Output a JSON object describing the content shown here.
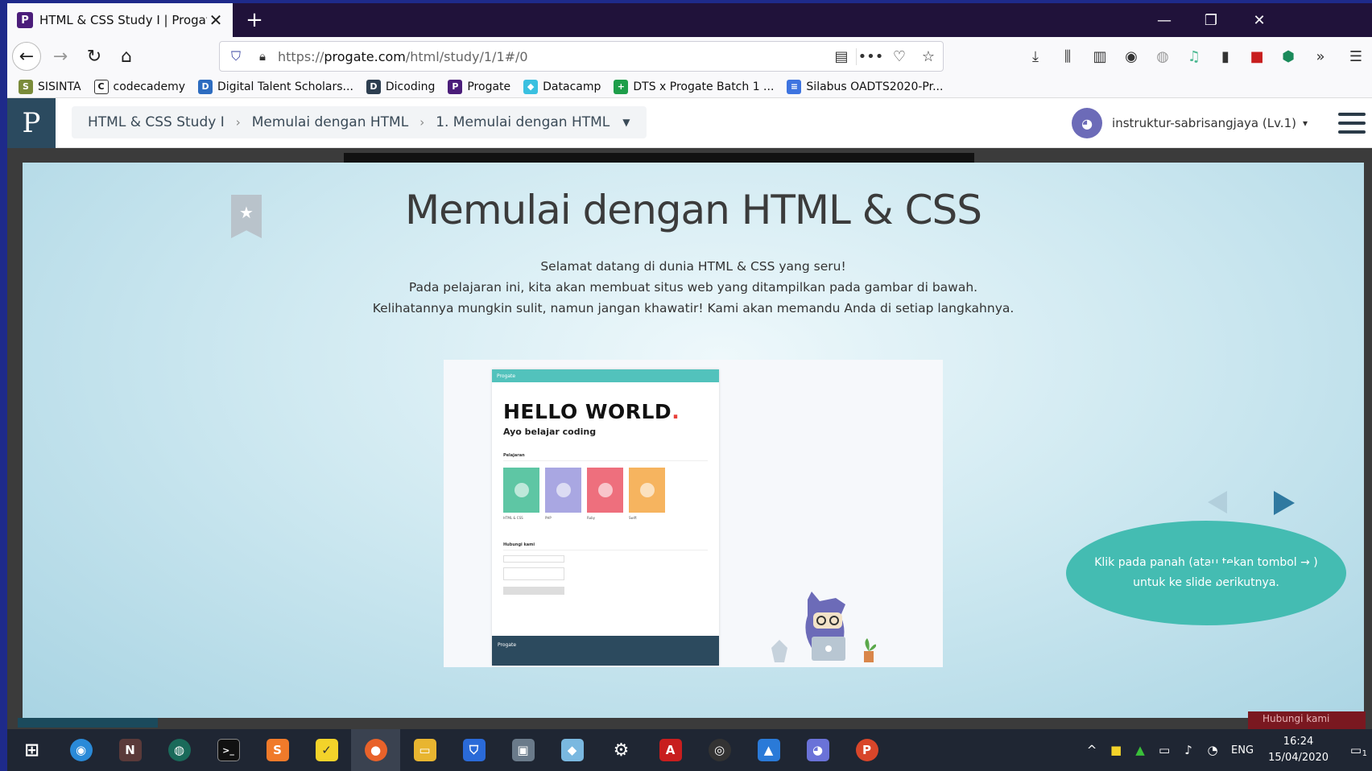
{
  "browser": {
    "tab_favicon": "P",
    "tab_title": "HTML & CSS Study I | Progate -",
    "tab_close": "✕",
    "new_tab": "+",
    "win_min": "—",
    "win_restore": "❐",
    "win_close": "✕",
    "back": "←",
    "forward": "→",
    "reload": "↻",
    "home": "⌂",
    "url_prefix": "https://",
    "url_host": "progate.com",
    "url_path": "/html/study/1/1#/0",
    "url_menu": "•••",
    "toolbar_icons": [
      "download-icon",
      "library-icon",
      "sidebar-icon",
      "account-icon",
      "globe-icon",
      "music-icon",
      "extension-icon",
      "pdf-icon",
      "shield-ext-icon",
      "overflow-icon",
      "menu-icon"
    ]
  },
  "bookmarks": [
    {
      "label": "SISINTA",
      "icon": "sisinta-icon",
      "color": "#7a8b3a",
      "glyph": "S"
    },
    {
      "label": "codecademy",
      "icon": "codecademy-icon",
      "color": "#ffffff",
      "glyph": "C"
    },
    {
      "label": "Digital Talent Scholars...",
      "icon": "dts-icon",
      "color": "#2d6cc0",
      "glyph": "D"
    },
    {
      "label": "Dicoding",
      "icon": "dicoding-icon",
      "color": "#2d3e50",
      "glyph": "D"
    },
    {
      "label": "Progate",
      "icon": "progate-icon",
      "color": "#4b1d7a",
      "glyph": "P"
    },
    {
      "label": "Datacamp",
      "icon": "datacamp-icon",
      "color": "#3ac0e0",
      "glyph": "◆"
    },
    {
      "label": "DTS x Progate Batch 1 ...",
      "icon": "sheets-icon",
      "color": "#1e9e4a",
      "glyph": "+"
    },
    {
      "label": "Silabus OADTS2020-Pr...",
      "icon": "docs-icon",
      "color": "#3e74e0",
      "glyph": "≡"
    }
  ],
  "header": {
    "logo": "P",
    "crumbs": [
      "HTML & CSS Study I",
      "Memulai dengan HTML",
      "1. Memulai dengan HTML"
    ],
    "crumb_sep": "›",
    "crumb_caret": "▼",
    "user_name": "instruktur-sabrisangjaya (Lv.1)",
    "user_caret": "▾"
  },
  "slide": {
    "star": "★",
    "title": "Memulai dengan HTML & CSS",
    "lines": [
      "Selamat datang di dunia HTML & CSS yang seru!",
      "Pada pelajaran ini, kita akan membuat situs web yang ditampilkan pada gambar di bawah.",
      "Kelihatannya mungkin sulit, namun jangan khawatir! Kami akan memandu Anda di setiap langkahnya."
    ],
    "mock": {
      "nav": "Progate",
      "hello": "HELLO WORLD",
      "dot": ".",
      "subtitle": "Ayo belajar coding",
      "section_lessons": "Pelajaran",
      "cards": [
        {
          "label": "HTML & CSS",
          "color": "#5ec6a4"
        },
        {
          "label": "PHP",
          "color": "#a9a7e2"
        },
        {
          "label": "Ruby",
          "color": "#ee6f7d"
        },
        {
          "label": "Swift",
          "color": "#f6b45f"
        }
      ],
      "section_contact": "Hubungi kami",
      "footer": "Progate"
    },
    "bubble_line1": "Klik pada panah (atau tekan tombol → )",
    "bubble_line2": "untuk ke slide berikutnya.",
    "hidden_button": "Hubungi kami"
  },
  "taskbar": {
    "apps": [
      {
        "name": "start-icon",
        "color": "#1f2633",
        "glyph": "⊞"
      },
      {
        "name": "wifi-app-icon",
        "color": "#2a8ad8",
        "glyph": "◉"
      },
      {
        "name": "nox-icon",
        "color": "#5a3a3a",
        "glyph": "N"
      },
      {
        "name": "gitkraken-icon",
        "color": "#1a6a5a",
        "glyph": "◍"
      },
      {
        "name": "terminal-icon",
        "color": "#111111",
        "glyph": ">_"
      },
      {
        "name": "sublime-icon",
        "color": "#f07a2a",
        "glyph": "S"
      },
      {
        "name": "sticky-notes-icon",
        "color": "#f3d32a",
        "glyph": "✓"
      },
      {
        "name": "firefox-icon",
        "color": "#e8622a",
        "glyph": "●"
      },
      {
        "name": "file-explorer-icon",
        "color": "#e8b530",
        "glyph": "▭"
      },
      {
        "name": "windows-security-icon",
        "color": "#2a6ad8",
        "glyph": "⛉"
      },
      {
        "name": "remote-desktop-icon",
        "color": "#6a7a8a",
        "glyph": "▣"
      },
      {
        "name": "app-blue-icon",
        "color": "#7ab8e0",
        "glyph": "◆"
      },
      {
        "name": "settings-icon",
        "color": "#1f2633",
        "glyph": "⚙"
      },
      {
        "name": "acrobat-icon",
        "color": "#c81e1e",
        "glyph": "A"
      },
      {
        "name": "obs-icon",
        "color": "#333333",
        "glyph": "◎"
      },
      {
        "name": "photos-icon",
        "color": "#2a7ad8",
        "glyph": "▲"
      },
      {
        "name": "discord-icon",
        "color": "#6a72d8",
        "glyph": "◕"
      },
      {
        "name": "powerpoint-icon",
        "color": "#d8462a",
        "glyph": "P"
      }
    ],
    "tray_up": "^",
    "language": "ENG",
    "time": "16:24",
    "date": "15/04/2020",
    "notifications": "1"
  }
}
